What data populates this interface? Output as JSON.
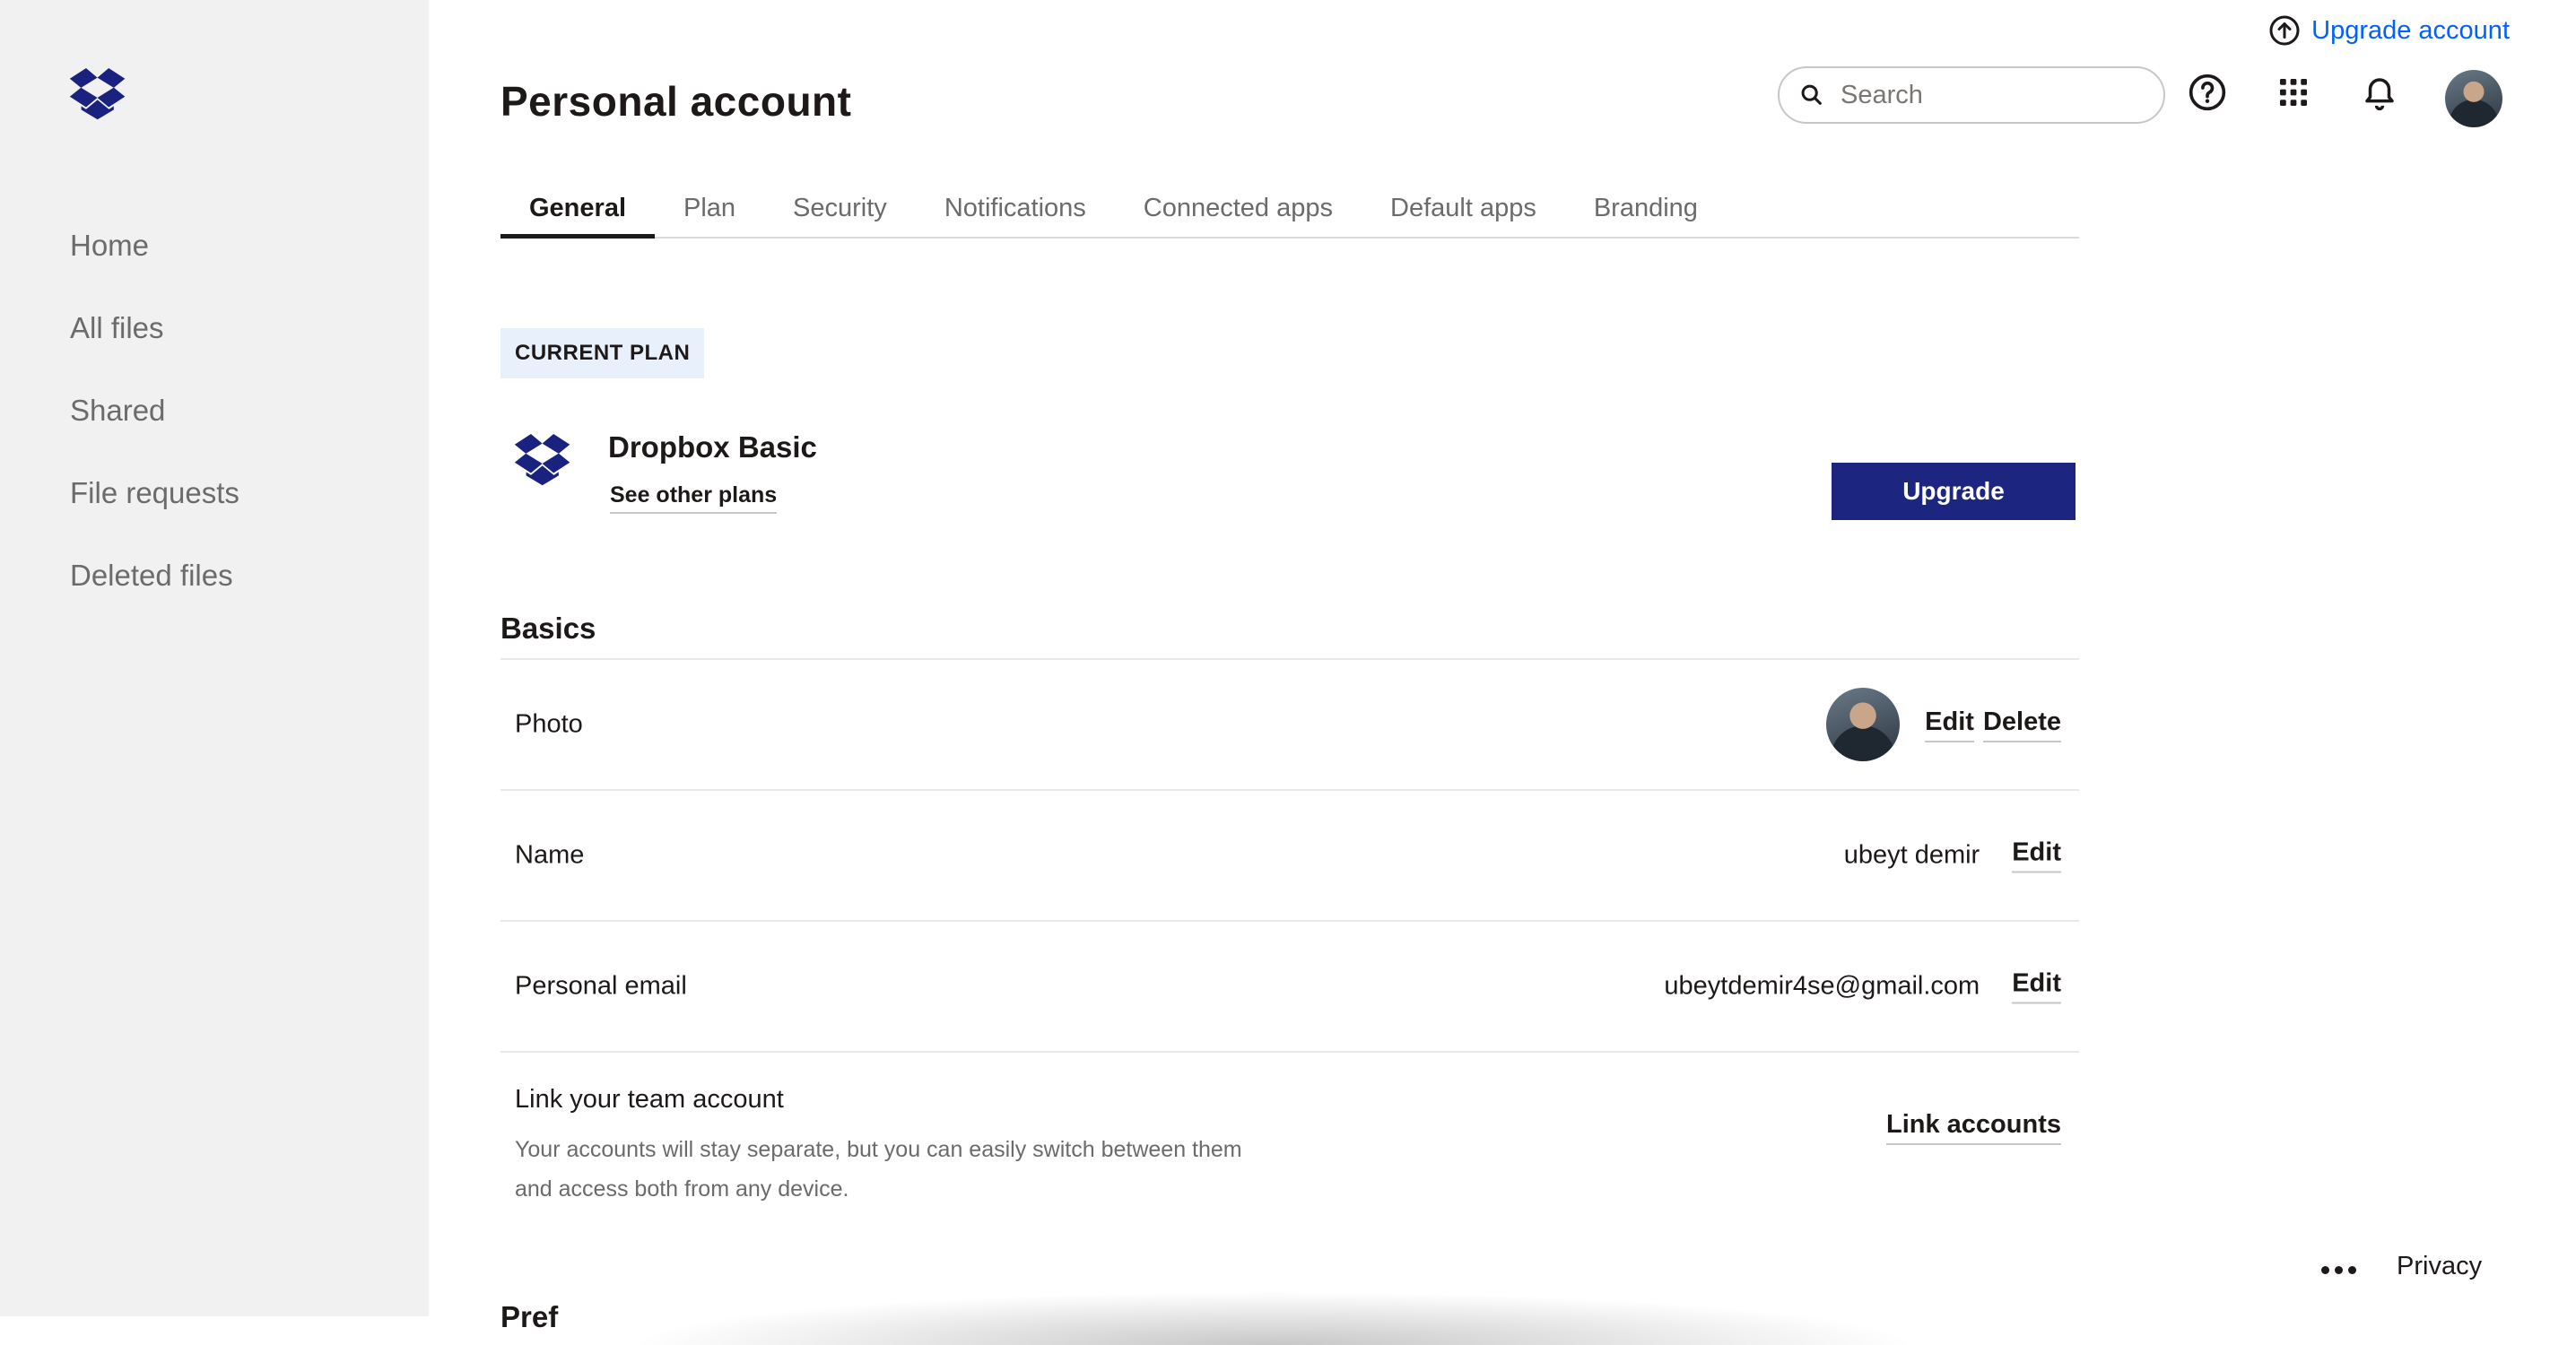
{
  "sidebar": {
    "logo": "dropbox-logo",
    "items": [
      {
        "label": "Home"
      },
      {
        "label": "All files"
      },
      {
        "label": "Shared"
      },
      {
        "label": "File requests"
      },
      {
        "label": "Deleted files"
      }
    ]
  },
  "header": {
    "upgrade_link": "Upgrade account",
    "title": "Personal account",
    "search_placeholder": "Search",
    "icons": [
      "help-icon",
      "apps-grid-icon",
      "bell-icon"
    ]
  },
  "tabs": [
    {
      "label": "General",
      "active": true
    },
    {
      "label": "Plan"
    },
    {
      "label": "Security"
    },
    {
      "label": "Notifications"
    },
    {
      "label": "Connected apps"
    },
    {
      "label": "Default apps"
    },
    {
      "label": "Branding"
    }
  ],
  "plan": {
    "badge": "CURRENT PLAN",
    "name": "Dropbox Basic",
    "link": "See other plans",
    "upgrade_button": "Upgrade"
  },
  "basics": {
    "title": "Basics",
    "photo": {
      "label": "Photo",
      "edit": "Edit",
      "delete": "Delete"
    },
    "name": {
      "label": "Name",
      "value": "ubeyt demir",
      "edit": "Edit"
    },
    "email": {
      "label": "Personal email",
      "value": "ubeytdemir4se@gmail.com",
      "edit": "Edit"
    },
    "team": {
      "label": "Link your team account",
      "description": "Your accounts will stay separate, but you can easily switch between them and access both from any device.",
      "action": "Link accounts"
    }
  },
  "next_section_partial": "Pref",
  "footer": {
    "privacy": "Privacy"
  },
  "colors": {
    "sidebar_bg": "#f1f1f1",
    "link_blue": "#0061fe",
    "upgrade_button": "#1c2580",
    "logo_blue": "#1a2280"
  }
}
